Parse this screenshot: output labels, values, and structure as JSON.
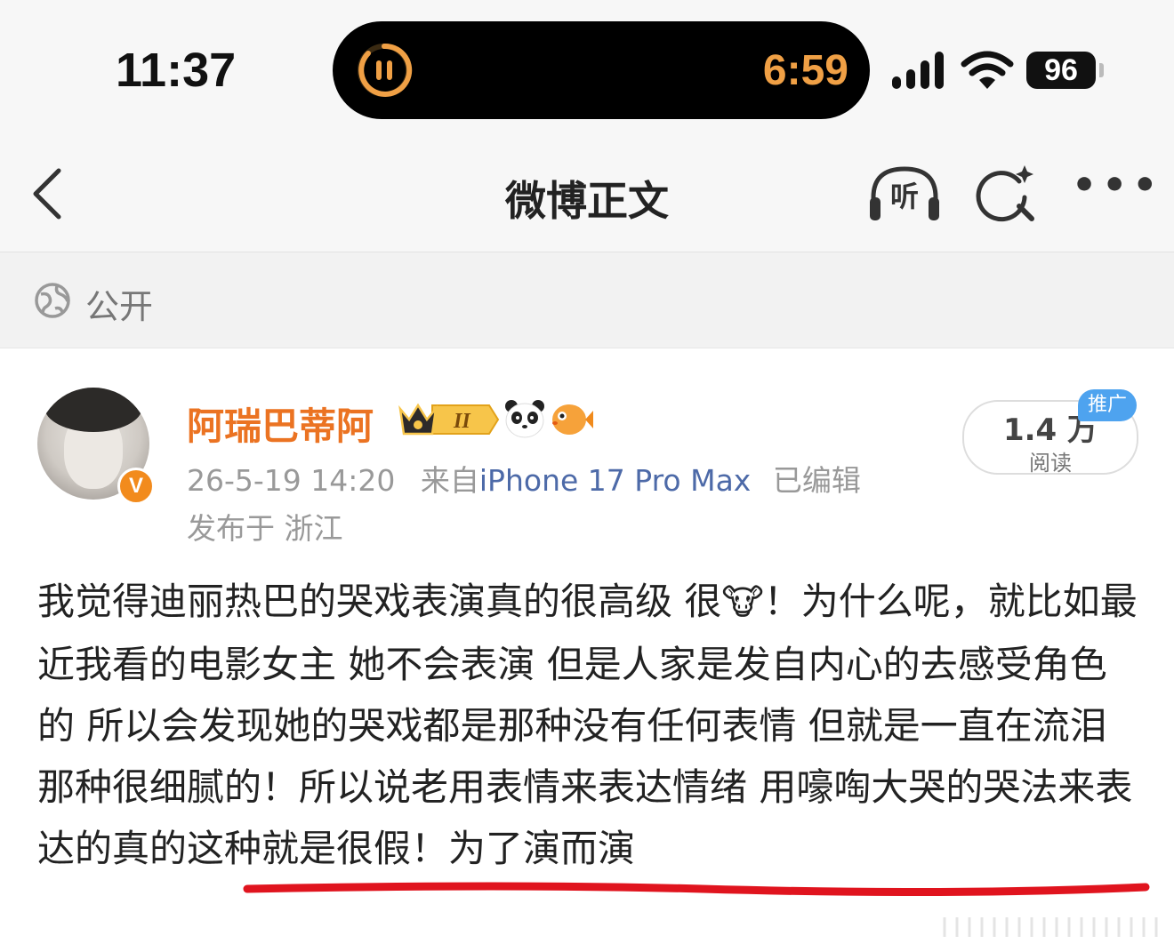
{
  "status_bar": {
    "time": "11:37",
    "island_timer": "6:59",
    "battery": "96",
    "accent_color": "#f0a045"
  },
  "nav": {
    "title": "微博正文",
    "listen_label": "听",
    "icons": [
      "back-chevron-icon",
      "headphones-icon",
      "ai-search-icon",
      "more-dots-icon"
    ]
  },
  "visibility": {
    "label": "公开",
    "icon": "globe-icon"
  },
  "post": {
    "username": "阿瑞巴蒂阿",
    "username_color": "#eb7322",
    "badges": [
      "crown-level-badge",
      "panda-emoji-icon",
      "pufferfish-emoji-icon"
    ],
    "crown_level": "II",
    "verified_mark": "V",
    "date": "26-5-19 14:20",
    "source_prefix": "来自",
    "device": "iPhone 17 Pro Max",
    "edited": "已编辑",
    "location": "发布于 浙江",
    "reads_count": "1.4 万",
    "reads_label": "阅读",
    "promo_tag": "推广",
    "text_part1": "我觉得迪丽热巴的哭戏表演真的很高级 很",
    "cow_emoji": "🐮",
    "text_part2": "！为什么呢，就比如最近我看的电影女主 她不会表演 但是人家是发自内心的去感受角色的 所以会发现她的哭戏都是那种没有任何表情 但就是一直在流泪 那种很细腻的！所以说老用表情来表达情绪 用嚎啕大哭的哭法来表达的真的这种就是很假！为了演而演",
    "annotation_color": "#e0141e"
  }
}
